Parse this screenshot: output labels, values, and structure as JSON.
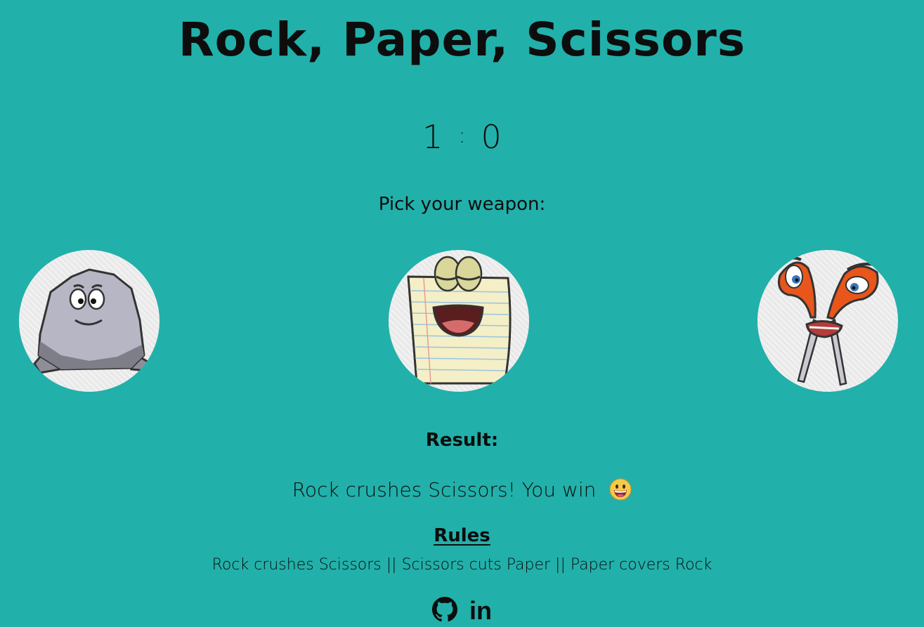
{
  "title": "Rock, Paper, Scissors",
  "score": {
    "player": "1",
    "separator": ":",
    "computer": "0"
  },
  "prompt": "Pick your weapon:",
  "weapons": [
    {
      "name": "rock",
      "icon": "rock-character"
    },
    {
      "name": "paper",
      "icon": "paper-character"
    },
    {
      "name": "scissors",
      "icon": "scissors-character"
    }
  ],
  "result": {
    "label": "Result:",
    "message": "Rock crushes Scissors! You win",
    "emoji": "grinning-face"
  },
  "rules": {
    "heading": "Rules",
    "text": "Rock crushes Scissors || Scissors cuts Paper || Paper covers Rock"
  },
  "footer": {
    "github_icon": "github-icon",
    "linkedin_label": "in"
  },
  "colors": {
    "background": "#22b0aa",
    "text": "#0d0d0d",
    "circle": "#eeeeee"
  }
}
